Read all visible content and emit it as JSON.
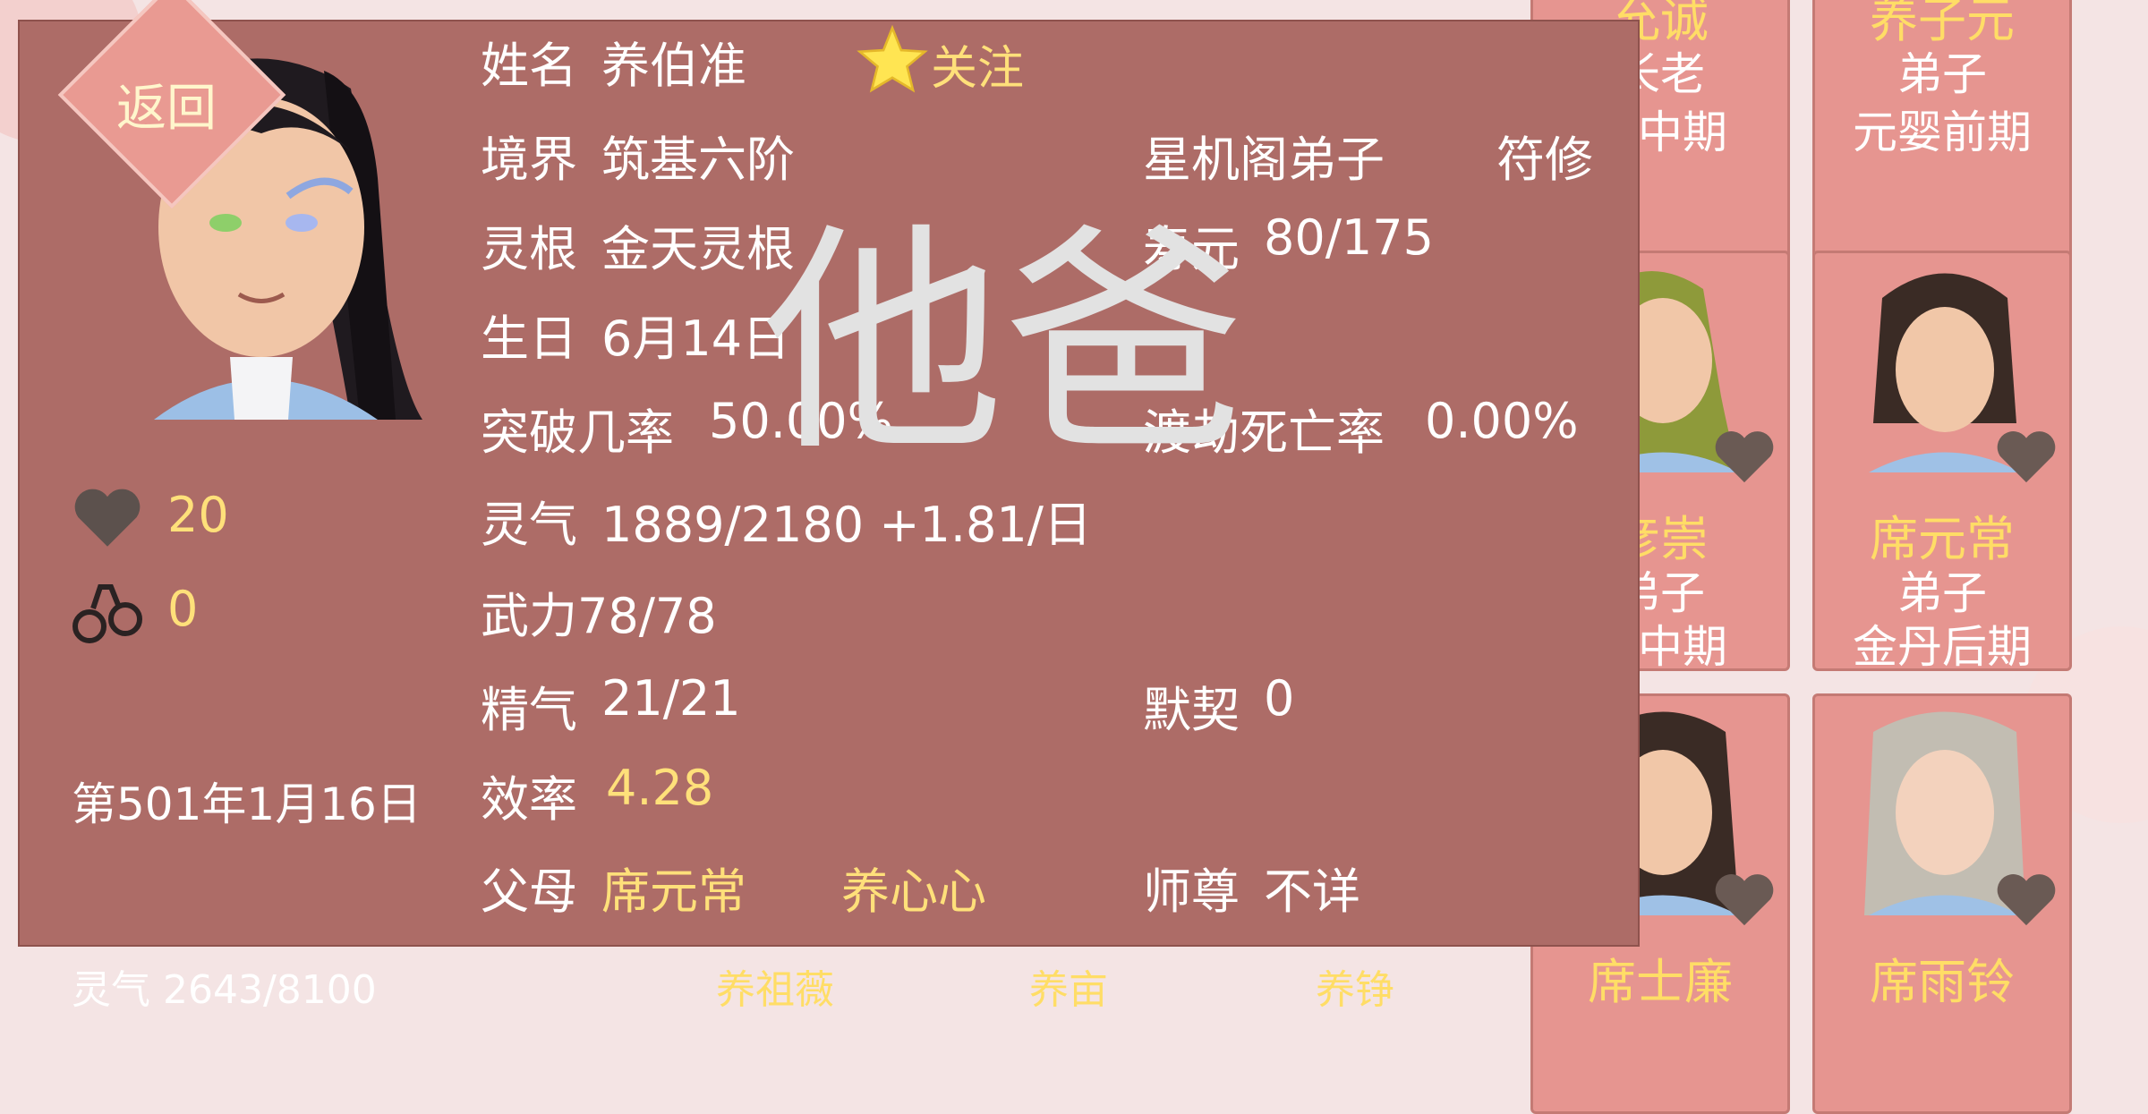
{
  "back_button": {
    "label": "返回"
  },
  "watermark": "他爸",
  "character": {
    "name_label": "姓名",
    "name": "养伯准",
    "follow_label": "关注",
    "realm_label": "境界",
    "realm": "筑基六阶",
    "sect": "星机阁弟子",
    "profession": "符修",
    "root_label": "灵根",
    "root": "金天灵根",
    "lifespan_label": "寿元",
    "lifespan": "80/175",
    "birthday_label": "生日",
    "birthday": "6月14日",
    "breakthrough_label": "突破几率",
    "breakthrough": "50.00%",
    "tribulation_label": "渡劫死亡率",
    "tribulation": "0.00%",
    "qi_label": "灵气",
    "qi": "1889/2180 +1.81/日",
    "power_text": "武力78/78",
    "essence_label": "精气",
    "essence": "21/21",
    "bond_label": "默契",
    "bond": "0",
    "efficiency_label": "效率",
    "efficiency": "4.28",
    "parents_label": "父母",
    "father": "席元常",
    "mother": "养心心",
    "master_label": "师尊",
    "master": "不详",
    "affection": "20",
    "restraint": "0",
    "date": "第501年1月16日"
  },
  "cards": [
    {
      "name": "允诚",
      "role": "长老",
      "rank": "体中期"
    },
    {
      "name": "养子元",
      "role": "弟子",
      "rank": "元婴前期"
    },
    {
      "name": "彦崇",
      "role": "弟子",
      "rank": "丹中期"
    },
    {
      "name": "席元常",
      "role": "弟子",
      "rank": "金丹后期"
    },
    {
      "name": "席士廉",
      "role": "",
      "rank": ""
    },
    {
      "name": "席雨铃",
      "role": "",
      "rank": ""
    }
  ],
  "bottom_row": {
    "qi_text": "灵气 2643/8100",
    "names": [
      "养祖薇",
      "养亩",
      "养铮"
    ]
  },
  "colors": {
    "panel": "#ad6c67",
    "gold": "#ffe07a",
    "card": "#e69590"
  },
  "icons": [
    "heart-icon",
    "handcuffs-icon",
    "star-icon"
  ]
}
